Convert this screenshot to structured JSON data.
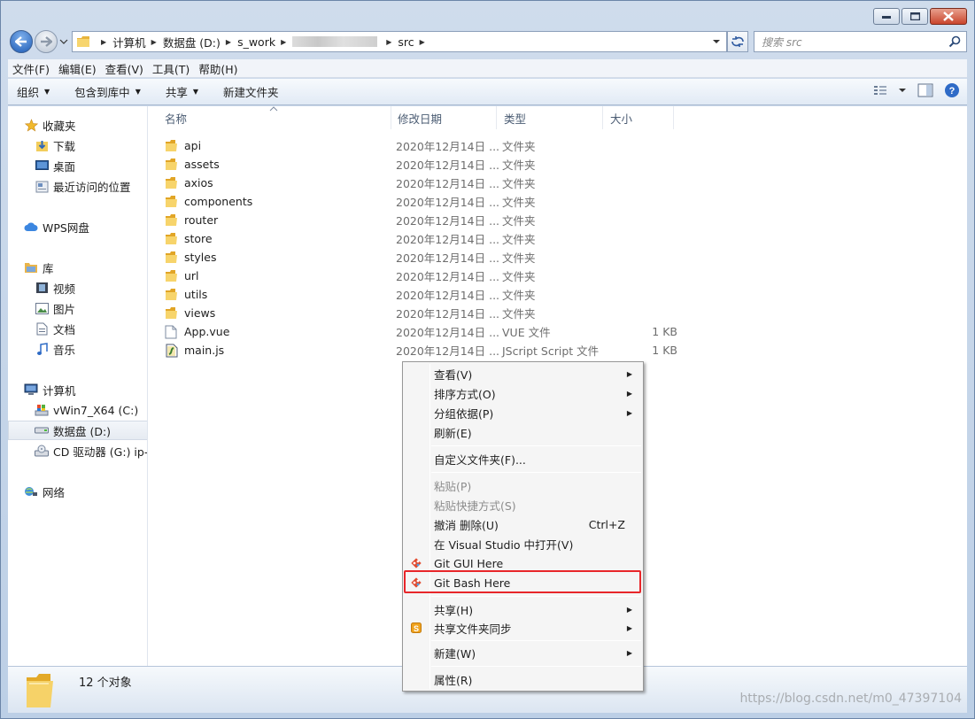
{
  "window": {
    "minimize": "minimize",
    "maximize": "maximize",
    "close": "close"
  },
  "address": {
    "crumbs": [
      "计算机",
      "数据盘 (D:)",
      "s_work",
      "src"
    ],
    "search_placeholder": "搜索 src"
  },
  "menubar": [
    "文件(F)",
    "编辑(E)",
    "查看(V)",
    "工具(T)",
    "帮助(H)"
  ],
  "cmdbar": {
    "organize": "组织",
    "include": "包含到库中",
    "share": "共享",
    "newfolder": "新建文件夹"
  },
  "nav": {
    "favorites": "收藏夹",
    "downloads": "下载",
    "desktop": "桌面",
    "recent": "最近访问的位置",
    "wps": "WPS网盘",
    "libraries": "库",
    "videos": "视频",
    "pictures": "图片",
    "documents": "文档",
    "music": "音乐",
    "computer": "计算机",
    "drive_c": "vWin7_X64 (C:)",
    "drive_d": "数据盘 (D:)",
    "drive_g": "CD 驱动器 (G:) ip-r",
    "network": "网络"
  },
  "columns": {
    "name": "名称",
    "date": "修改日期",
    "type": "类型",
    "size": "大小"
  },
  "files": [
    {
      "name": "api",
      "date": "2020年12月14日 ...",
      "type": "文件夹",
      "size": "",
      "icon": "folder-icon"
    },
    {
      "name": "assets",
      "date": "2020年12月14日 ...",
      "type": "文件夹",
      "size": "",
      "icon": "folder-icon"
    },
    {
      "name": "axios",
      "date": "2020年12月14日 ...",
      "type": "文件夹",
      "size": "",
      "icon": "folder-icon"
    },
    {
      "name": "components",
      "date": "2020年12月14日 ...",
      "type": "文件夹",
      "size": "",
      "icon": "folder-icon"
    },
    {
      "name": "router",
      "date": "2020年12月14日 ...",
      "type": "文件夹",
      "size": "",
      "icon": "folder-icon"
    },
    {
      "name": "store",
      "date": "2020年12月14日 ...",
      "type": "文件夹",
      "size": "",
      "icon": "folder-icon"
    },
    {
      "name": "styles",
      "date": "2020年12月14日 ...",
      "type": "文件夹",
      "size": "",
      "icon": "folder-icon"
    },
    {
      "name": "url",
      "date": "2020年12月14日 ...",
      "type": "文件夹",
      "size": "",
      "icon": "folder-icon"
    },
    {
      "name": "utils",
      "date": "2020年12月14日 ...",
      "type": "文件夹",
      "size": "",
      "icon": "folder-icon"
    },
    {
      "name": "views",
      "date": "2020年12月14日 ...",
      "type": "文件夹",
      "size": "",
      "icon": "folder-icon"
    },
    {
      "name": "App.vue",
      "date": "2020年12月14日 ...",
      "type": "VUE 文件",
      "size": "1 KB",
      "icon": "document-icon"
    },
    {
      "name": "main.js",
      "date": "2020年12月14日 ...",
      "type": "JScript Script 文件",
      "size": "1 KB",
      "icon": "script-icon"
    }
  ],
  "status": {
    "count": "12 个对象",
    "watermark": "https://blog.csdn.net/m0_47397104"
  },
  "context_menu": {
    "view": "查看(V)",
    "sort": "排序方式(O)",
    "group": "分组依据(P)",
    "refresh": "刷新(E)",
    "customize": "自定义文件夹(F)...",
    "paste": "粘贴(P)",
    "paste_shortcut": "粘贴快捷方式(S)",
    "undo": "撤消 删除(U)",
    "undo_shortcut": "Ctrl+Z",
    "vs": "在 Visual Studio 中打开(V)",
    "git_gui": "Git GUI Here",
    "git_bash": "Git Bash Here",
    "share": "共享(H)",
    "share_sync": "共享文件夹同步",
    "new": "新建(W)",
    "properties": "属性(R)"
  },
  "colors": {
    "highlight": "#e8262a",
    "folder": "#f4c542"
  }
}
